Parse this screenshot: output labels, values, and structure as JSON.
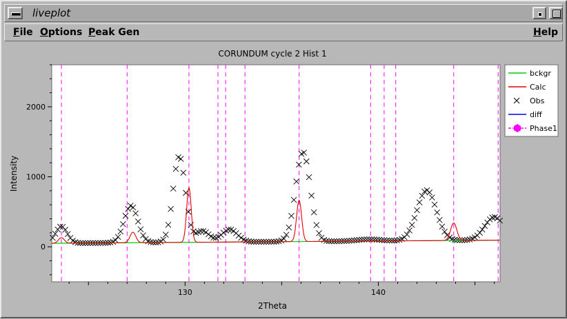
{
  "window": {
    "title": "liveplot",
    "sysmenu_icon": "window-menu-icon",
    "minimize_icon": "minimize-icon",
    "maximize_icon": "maximize-icon"
  },
  "menubar": {
    "file": {
      "first": "F",
      "rest": "ile"
    },
    "options": {
      "first": "O",
      "rest": "ptions"
    },
    "peakgen": {
      "first": "P",
      "rest": "eak Gen"
    },
    "help": {
      "first": "H",
      "rest": "elp"
    }
  },
  "chart_data": {
    "type": "scatter",
    "title": "CORUNDUM cycle 2 Hist 1",
    "xlabel": "2Theta",
    "ylabel": "Intensity",
    "xlim": [
      123.1,
      146.3
    ],
    "ylim": [
      -500,
      2600
    ],
    "xticks": [
      130,
      140
    ],
    "yticks": [
      0,
      1000,
      2000
    ],
    "grid": false,
    "legend_placement": "right",
    "colors": {
      "bckgr": "#00cc00",
      "calc": "#dd0000",
      "obs": "#000000",
      "diff": "#0000ee",
      "phase1": "#ff00ff"
    },
    "legend": [
      {
        "label": "bckgr",
        "kind": "line",
        "color": "#00cc00"
      },
      {
        "label": "Calc",
        "kind": "line",
        "color": "#dd0000"
      },
      {
        "label": "Obs",
        "kind": "x",
        "color": "#000000"
      },
      {
        "label": "diff",
        "kind": "line",
        "color": "#0000ee"
      },
      {
        "label": "Phase1",
        "kind": "marker",
        "color": "#ff00ff"
      }
    ],
    "bckgr": {
      "x": [
        123.1,
        146.3
      ],
      "y": [
        50,
        95
      ]
    },
    "obs_peaks": [
      {
        "center": 123.6,
        "height": 240,
        "width": 0.3
      },
      {
        "center": 127.2,
        "height": 530,
        "width": 0.35
      },
      {
        "center": 129.7,
        "height": 1230,
        "width": 0.32
      },
      {
        "center": 130.9,
        "height": 160,
        "width": 0.35
      },
      {
        "center": 132.3,
        "height": 180,
        "width": 0.4
      },
      {
        "center": 136.1,
        "height": 1280,
        "width": 0.38
      },
      {
        "center": 139.5,
        "height": 25,
        "width": 0.6
      },
      {
        "center": 142.5,
        "height": 720,
        "width": 0.5
      },
      {
        "center": 146.0,
        "height": 330,
        "width": 0.5
      }
    ],
    "calc_peaks": [
      {
        "center": 123.6,
        "height": 80,
        "width": 0.15
      },
      {
        "center": 127.3,
        "height": 150,
        "width": 0.15
      },
      {
        "center": 130.2,
        "height": 780,
        "width": 0.12
      },
      {
        "center": 135.9,
        "height": 590,
        "width": 0.13
      },
      {
        "center": 143.9,
        "height": 250,
        "width": 0.16
      }
    ],
    "phase1_reflections": [
      123.6,
      127.0,
      130.2,
      131.7,
      132.1,
      133.1,
      135.9,
      139.6,
      140.3,
      140.9,
      143.9,
      146.2
    ],
    "obs_range": {
      "start": 123.1,
      "end": 146.3,
      "step": 0.13
    }
  }
}
